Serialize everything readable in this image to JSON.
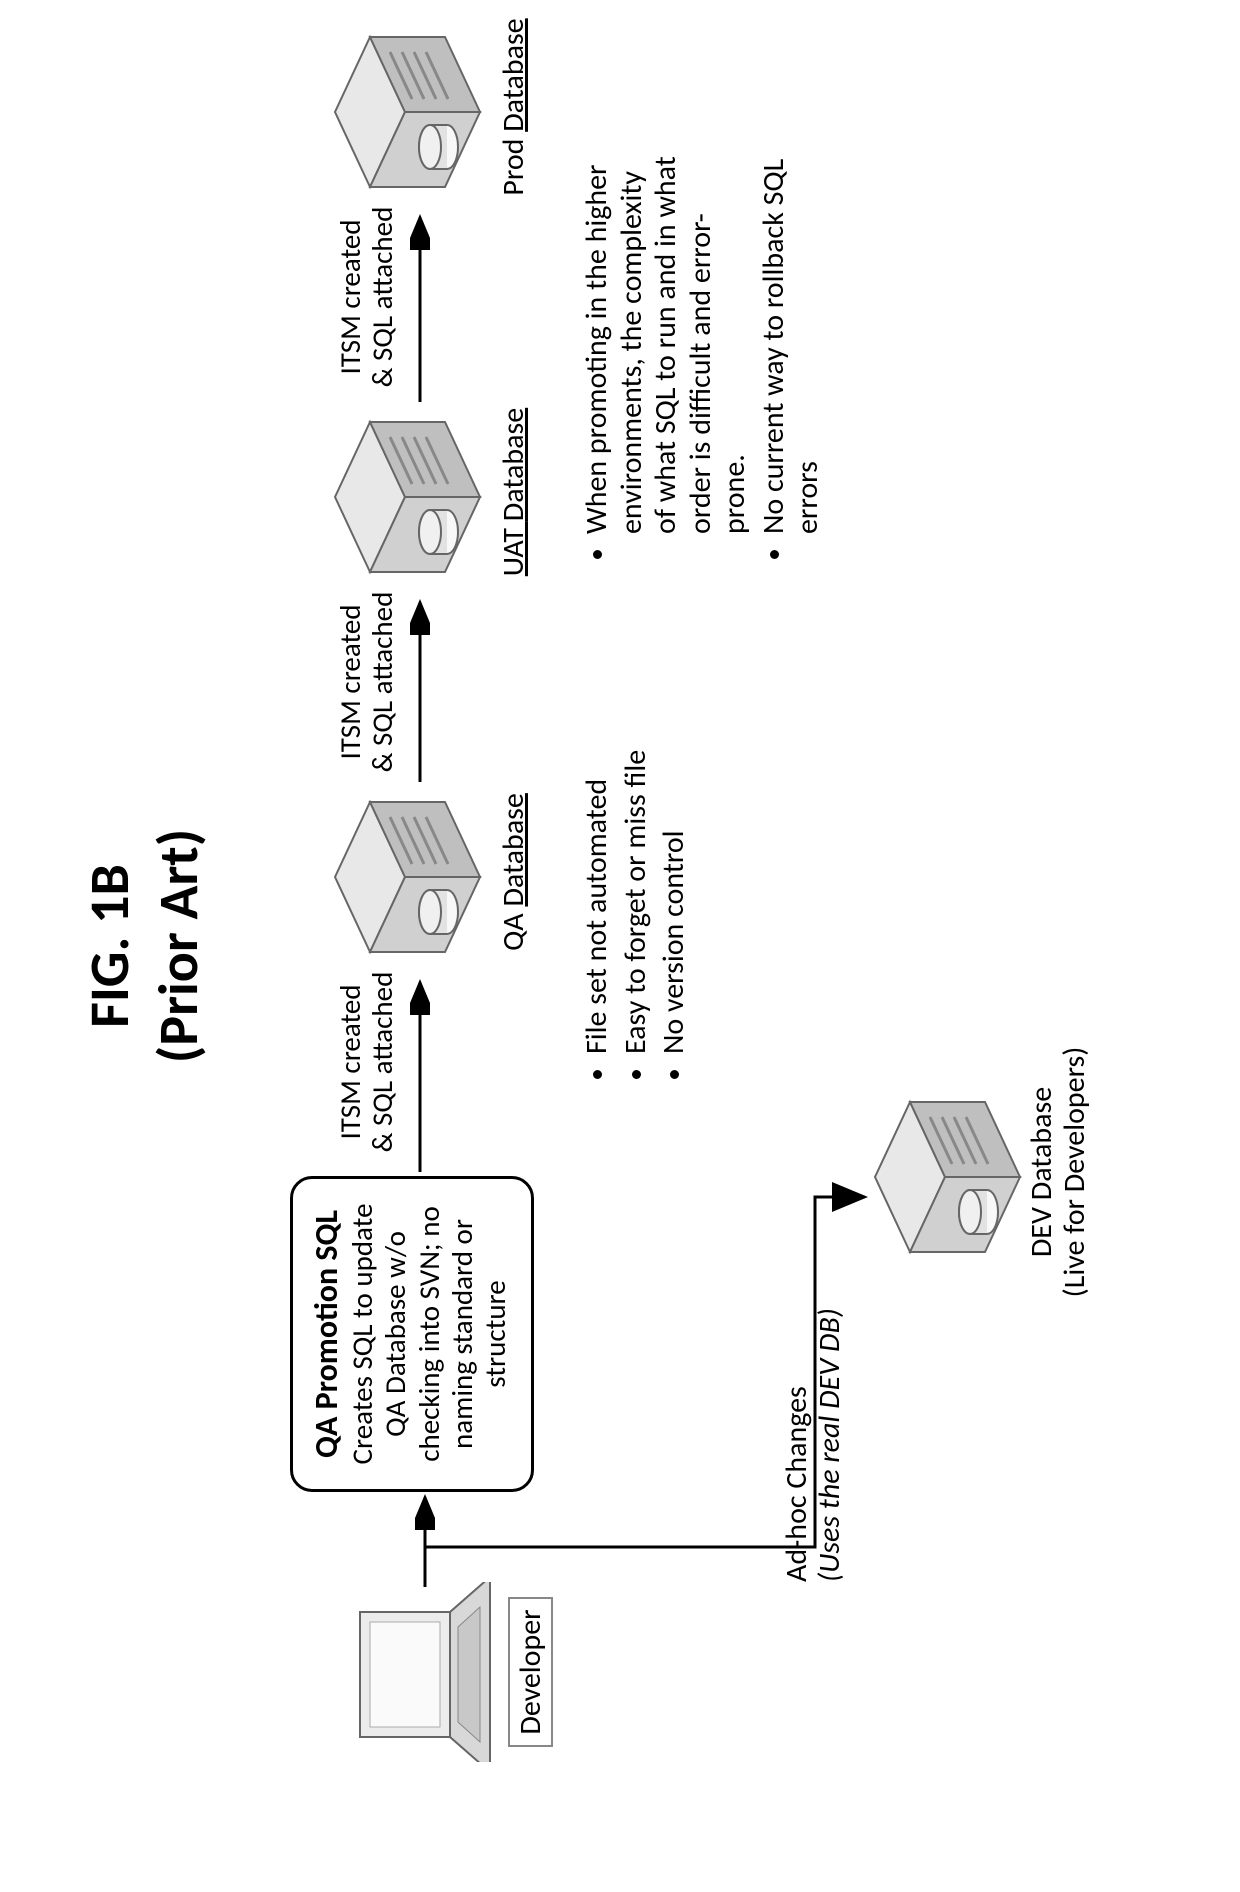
{
  "figure": {
    "number": "FIG. 1B",
    "subtitle": "(Prior Art)"
  },
  "developer_label": "Developer",
  "qa_box": {
    "title": "QA Promotion SQL",
    "body": "Creates SQL to update QA Database w/o checking into SVN; no naming standard or structure"
  },
  "itsm_label_line1": "ITSM created",
  "itsm_label_line2": "& SQL attached",
  "databases": {
    "qa": {
      "label_prefix": "QA  ",
      "label_word": "Database"
    },
    "uat": {
      "label_prefix": "UAT  ",
      "label_word": "Database"
    },
    "prod": {
      "label_prefix": "Prod  ",
      "label_word": "Database"
    },
    "dev": {
      "line1": "DEV Database",
      "line2": "(Live for Developers)"
    }
  },
  "bullets_left": [
    "File set not automated",
    "Easy to forget or miss file",
    "No version control"
  ],
  "bullets_right": [
    "When promoting in the higher environments, the complexity of what SQL to run and in what order is difficult and error-prone.",
    "No current way to rollback SQL errors"
  ],
  "adhoc": {
    "line1": "Ad-hoc Changes",
    "line2": "(Uses the real DEV DB)"
  }
}
